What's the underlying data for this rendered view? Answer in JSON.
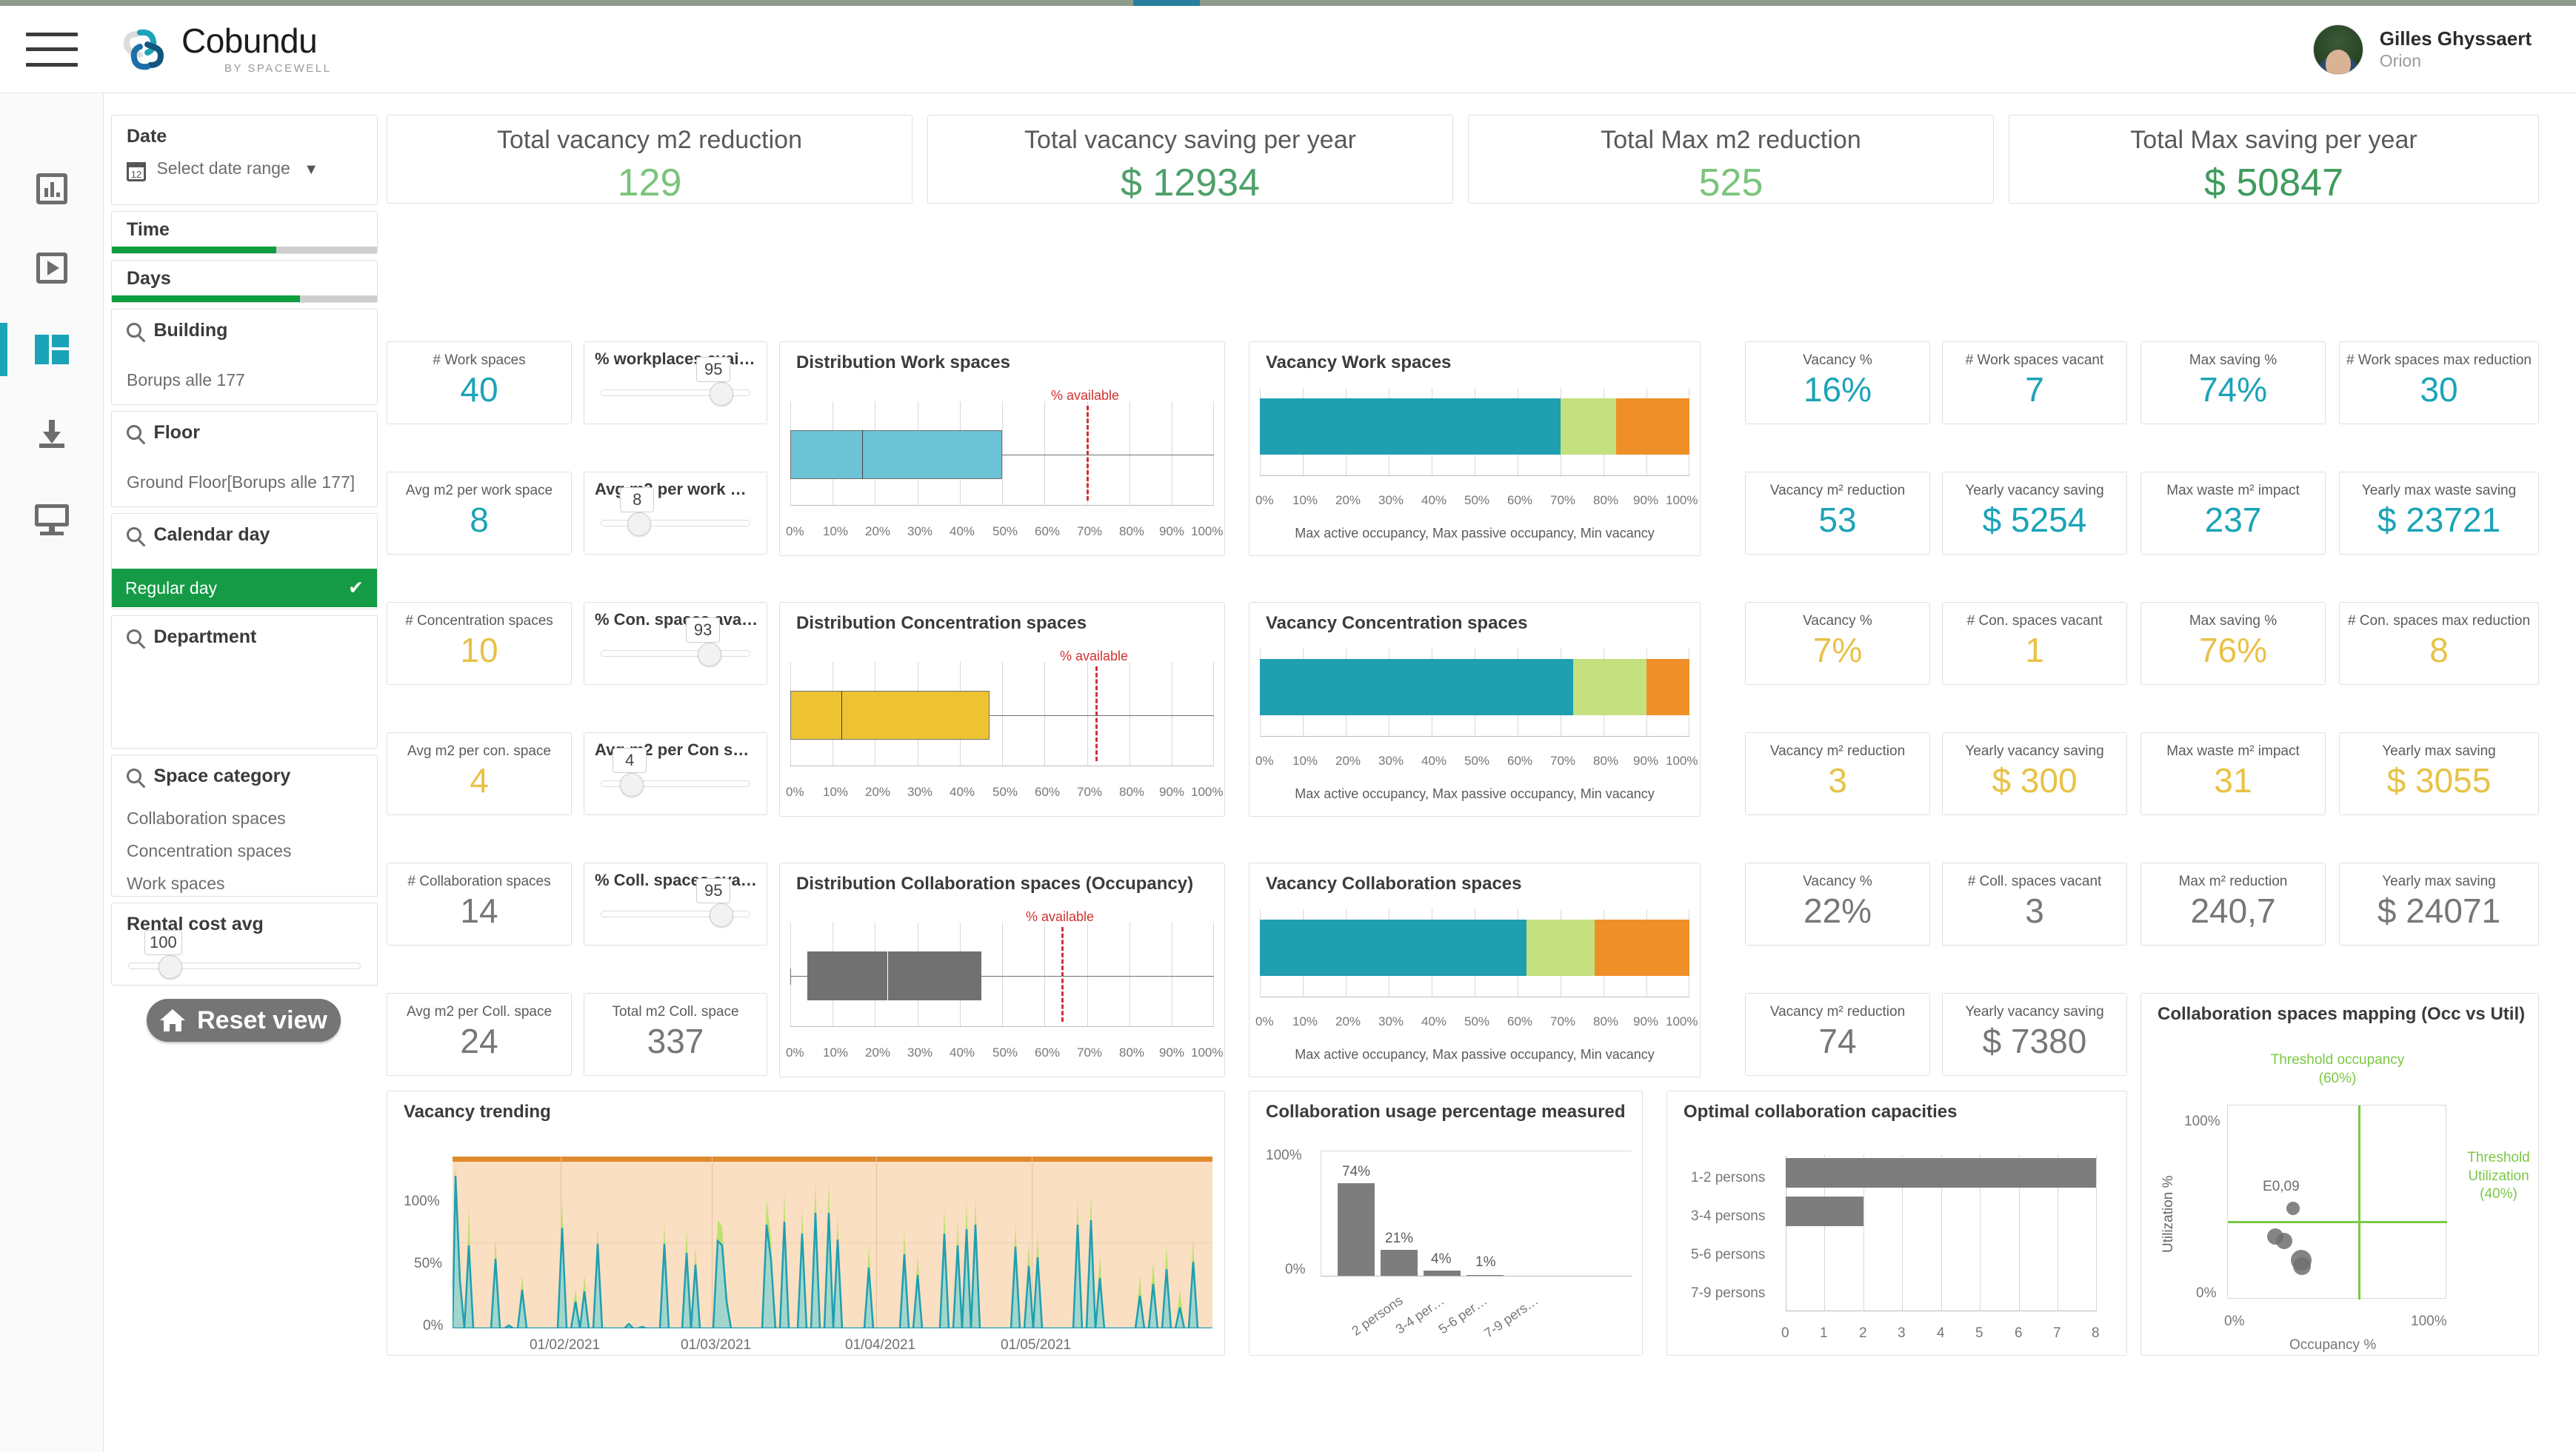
{
  "header": {
    "menu_icon": "hamburger-icon",
    "logo_title": "Cobundu",
    "logo_subtitle": "BY SPACEWELL",
    "user_name": "Gilles Ghyssaert",
    "user_role": "Orion"
  },
  "rail": {
    "items": [
      {
        "icon": "bar-chart-icon",
        "active": false
      },
      {
        "icon": "play-icon",
        "active": false
      },
      {
        "icon": "dashboard-grid-icon",
        "active": true
      },
      {
        "icon": "download-icon",
        "active": false
      },
      {
        "icon": "monitor-icon",
        "active": false
      }
    ]
  },
  "filters": {
    "date": {
      "title": "Date",
      "value": "Select date range",
      "icon": "calendar-icon",
      "caret": "▼"
    },
    "time": {
      "title": "Time",
      "fill_pct": 62
    },
    "days": {
      "title": "Days",
      "fill_pct": 71
    },
    "building": {
      "title": "Building",
      "values": [
        "Borups alle 177"
      ]
    },
    "floor": {
      "title": "Floor",
      "values": [
        "Ground Floor[Borups alle 177]"
      ]
    },
    "calendar_day": {
      "title": "Calendar day",
      "selected": "Regular day",
      "check": "✔"
    },
    "department": {
      "title": "Department",
      "values": []
    },
    "space_category": {
      "title": "Space category",
      "values": [
        "Collaboration spaces",
        "Concentration spaces",
        "Work spaces"
      ]
    },
    "rental_cost": {
      "title": "Rental cost avg",
      "value": "100",
      "knob_pct": 18
    },
    "reset_button": "Reset view"
  },
  "kpi_top": [
    {
      "title": "Total vacancy m2 reduction",
      "value": "129",
      "color": "#7cc47c"
    },
    {
      "title": "Total vacancy saving per year",
      "value": "$ 12934",
      "color": "#4fa06a"
    },
    {
      "title": "Total Max m2 reduction",
      "value": "525",
      "color": "#7cc47c"
    },
    {
      "title": "Total Max saving per year",
      "value": "$ 50847",
      "color": "#3f9b5d"
    }
  ],
  "kpi_left": [
    {
      "title": "# Work spaces",
      "value": "40",
      "tone": "teal"
    },
    {
      "title": "Avg m2 per work space",
      "value": "8",
      "tone": "teal"
    },
    {
      "title": "# Concentration spaces",
      "value": "10",
      "tone": "gold"
    },
    {
      "title": "Avg m2 per con. space",
      "value": "4",
      "tone": "gold"
    },
    {
      "title": "# Collaboration spaces",
      "value": "14",
      "tone": "grey"
    },
    {
      "title": "Avg m2 per Coll. space",
      "value": "24",
      "tone": "grey"
    }
  ],
  "sliders": [
    {
      "title": "% workplaces avai…",
      "value": "95",
      "knob_pct": 76
    },
    {
      "title": "Avg m2 per work …",
      "value": "8",
      "knob_pct": 22
    },
    {
      "title": "% Con. spaces ava…",
      "value": "93",
      "knob_pct": 70
    },
    {
      "title": "Avg m2 per Con s…",
      "value": "4",
      "knob_pct": 17
    },
    {
      "title": "% Coll. spaces ava…",
      "value": "95",
      "knob_pct": 76
    },
    {
      "title": "Total m2 Coll. space",
      "value": "337",
      "knob_pct": 0,
      "is_kpi": true,
      "tone": "grey"
    }
  ],
  "kpi_right": [
    {
      "title": "Vacancy %",
      "value": "16%",
      "tone": "teal"
    },
    {
      "title": "# Work spaces vacant",
      "value": "7",
      "tone": "teal"
    },
    {
      "title": "Max saving %",
      "value": "74%",
      "tone": "teal"
    },
    {
      "title": "# Work spaces max reduction",
      "value": "30",
      "tone": "teal"
    },
    {
      "title": "Vacancy m² reduction",
      "value": "53",
      "tone": "teal"
    },
    {
      "title": "Yearly vacancy saving",
      "value": "$ 5254",
      "tone": "teal"
    },
    {
      "title": "Max waste m² impact",
      "value": "237",
      "tone": "teal"
    },
    {
      "title": "Yearly max waste saving",
      "value": "$ 23721",
      "tone": "teal"
    },
    {
      "title": "Vacancy %",
      "value": "7%",
      "tone": "gold"
    },
    {
      "title": "# Con. spaces vacant",
      "value": "1",
      "tone": "gold"
    },
    {
      "title": "Max saving %",
      "value": "76%",
      "tone": "gold"
    },
    {
      "title": "# Con. spaces max reduction",
      "value": "8",
      "tone": "gold"
    },
    {
      "title": "Vacancy m² reduction",
      "value": "3",
      "tone": "gold"
    },
    {
      "title": "Yearly vacancy saving",
      "value": "$ 300",
      "tone": "gold"
    },
    {
      "title": "Max waste m² impact",
      "value": "31",
      "tone": "gold"
    },
    {
      "title": "Yearly max saving",
      "value": "$ 3055",
      "tone": "gold"
    },
    {
      "title": "Vacancy %",
      "value": "22%",
      "tone": "grey"
    },
    {
      "title": "# Coll. spaces vacant",
      "value": "3",
      "tone": "grey"
    },
    {
      "title": "Max m² reduction",
      "value": "240,7",
      "tone": "grey"
    },
    {
      "title": "Yearly max saving",
      "value": "$ 24071",
      "tone": "grey"
    },
    {
      "title": "Vacancy m² reduction",
      "value": "74",
      "tone": "grey"
    },
    {
      "title": "Yearly vacancy saving",
      "value": "$ 7380",
      "tone": "grey"
    }
  ],
  "chart_data": [
    {
      "id": "dist_work",
      "type": "box",
      "title": "Distribution Work spaces",
      "ticks": [
        "0%",
        "10%",
        "20%",
        "30%",
        "40%",
        "50%",
        "60%",
        "70%",
        "80%",
        "90%",
        "100%"
      ],
      "xlim": [
        0,
        100
      ],
      "box": {
        "q1": 0,
        "median": 17,
        "q3": 50,
        "whisker_low": 0,
        "whisker_high": 100
      },
      "threshold": {
        "label": "% available",
        "value": 70,
        "color": "#d33030"
      },
      "color": "#6cc3d5"
    },
    {
      "id": "dist_conc",
      "type": "box",
      "title": "Distribution Concentration spaces",
      "ticks": [
        "0%",
        "10%",
        "20%",
        "30%",
        "40%",
        "50%",
        "60%",
        "70%",
        "80%",
        "90%",
        "100%"
      ],
      "xlim": [
        0,
        100
      ],
      "box": {
        "q1": 0,
        "median": 12,
        "q3": 47,
        "whisker_low": 0,
        "whisker_high": 100
      },
      "threshold": {
        "label": "% available",
        "value": 72,
        "color": "#d33030"
      },
      "color": "#edc333"
    },
    {
      "id": "dist_coll",
      "type": "box",
      "title": "Distribution Collaboration spaces (Occupancy)",
      "ticks": [
        "0%",
        "10%",
        "20%",
        "30%",
        "40%",
        "50%",
        "60%",
        "70%",
        "80%",
        "90%",
        "100%"
      ],
      "xlim": [
        0,
        100
      ],
      "box": {
        "q1": 4,
        "median": 23,
        "q3": 45,
        "whisker_low": 0,
        "whisker_high": 100
      },
      "threshold": {
        "label": "% available",
        "value": 64,
        "color": "#d33030"
      },
      "color": "#717171"
    },
    {
      "id": "vac_work",
      "type": "bar",
      "orientation": "stacked-horizontal",
      "title": "Vacancy Work spaces",
      "ticks": [
        "0%",
        "10%",
        "20%",
        "30%",
        "40%",
        "50%",
        "60%",
        "70%",
        "80%",
        "90%",
        "100%"
      ],
      "xlabel": "Max active occupancy, Max passive occupancy, Min vacancy",
      "series": [
        {
          "name": "Max active occupancy",
          "value": 70,
          "color": "#1f9fb0"
        },
        {
          "name": "Max passive occupancy",
          "value": 13,
          "color": "#c4e07f"
        },
        {
          "name": "Min vacancy",
          "value": 17,
          "color": "#ef8f28"
        }
      ]
    },
    {
      "id": "vac_conc",
      "type": "bar",
      "orientation": "stacked-horizontal",
      "title": "Vacancy Concentration spaces",
      "ticks": [
        "0%",
        "10%",
        "20%",
        "30%",
        "40%",
        "50%",
        "60%",
        "70%",
        "80%",
        "90%",
        "100%"
      ],
      "xlabel": "Max active occupancy, Max passive occupancy, Min vacancy",
      "series": [
        {
          "name": "Max active occupancy",
          "value": 73,
          "color": "#1f9fb0"
        },
        {
          "name": "Max passive occupancy",
          "value": 17,
          "color": "#c4e07f"
        },
        {
          "name": "Min vacancy",
          "value": 10,
          "color": "#ef8f28"
        }
      ]
    },
    {
      "id": "vac_coll",
      "type": "bar",
      "orientation": "stacked-horizontal",
      "title": "Vacancy Collaboration spaces",
      "ticks": [
        "0%",
        "10%",
        "20%",
        "30%",
        "40%",
        "50%",
        "60%",
        "70%",
        "80%",
        "90%",
        "100%"
      ],
      "xlabel": "Max active occupancy, Max passive occupancy, Min vacancy",
      "series": [
        {
          "name": "Max active occupancy",
          "value": 62,
          "color": "#1f9fb0"
        },
        {
          "name": "Max passive occupancy",
          "value": 16,
          "color": "#c4e07f"
        },
        {
          "name": "Min vacancy",
          "value": 22,
          "color": "#ef8f28"
        }
      ]
    },
    {
      "id": "vac_trend",
      "type": "area",
      "title": "Vacancy trending",
      "ylabel": "",
      "yticks": [
        "0%",
        "50%",
        "100%"
      ],
      "ylim": [
        0,
        100
      ],
      "xticks": [
        "01/02/2021",
        "01/03/2021",
        "01/04/2021",
        "01/05/2021"
      ],
      "series": [
        {
          "name": "Vacancy upper",
          "color": "#b9e06a"
        },
        {
          "name": "Vacancy lower",
          "color": "#1f9fb0"
        }
      ],
      "background": "#fadfc2"
    },
    {
      "id": "coll_usage",
      "type": "bar",
      "title": "Collaboration usage percentage measured",
      "categories": [
        "2 persons",
        "3-4 per…",
        "5-6 per…",
        "7-9 pers…"
      ],
      "values": [
        74,
        21,
        4,
        1
      ],
      "data_labels": [
        "74%",
        "21%",
        "4%",
        "1%"
      ],
      "yticks": [
        "0%",
        "100%"
      ],
      "ylim": [
        0,
        100
      ],
      "color": "#7d7d7d"
    },
    {
      "id": "opt_cap",
      "type": "bar",
      "orientation": "horizontal",
      "title": "Optimal collaboration capacities",
      "categories": [
        "1-2 persons",
        "3-4 persons",
        "5-6 persons",
        "7-9 persons"
      ],
      "values": [
        8,
        2,
        0,
        0
      ],
      "xticks": [
        "0",
        "1",
        "2",
        "3",
        "4",
        "5",
        "6",
        "7",
        "8"
      ],
      "xlim": [
        0,
        8
      ],
      "color": "#7d7d7d"
    },
    {
      "id": "coll_map",
      "type": "scatter",
      "title": "Collaboration spaces mapping (Occ vs Util)",
      "xlabel": "Occupancy %",
      "ylabel": "Utilization %",
      "xticks": [
        "0%",
        "100%"
      ],
      "yticks": [
        "0%",
        "100%"
      ],
      "xlim": [
        0,
        100
      ],
      "ylim": [
        0,
        100
      ],
      "points": [
        {
          "label": "E0,09",
          "x": 29,
          "y": 46,
          "r": 9
        },
        {
          "x": 21,
          "y": 33,
          "r": 11
        },
        {
          "x": 25,
          "y": 31,
          "r": 11
        },
        {
          "x": 31,
          "y": 23,
          "r": 14
        },
        {
          "x": 32,
          "y": 20,
          "r": 12
        }
      ],
      "thresholds": [
        {
          "label": "Threshold occupancy (60%)",
          "axis": "x",
          "value": 60,
          "color": "#7ac943"
        },
        {
          "label": "Threshold Utilization (40%)",
          "axis": "y",
          "value": 40,
          "color": "#7ac943"
        }
      ]
    }
  ]
}
